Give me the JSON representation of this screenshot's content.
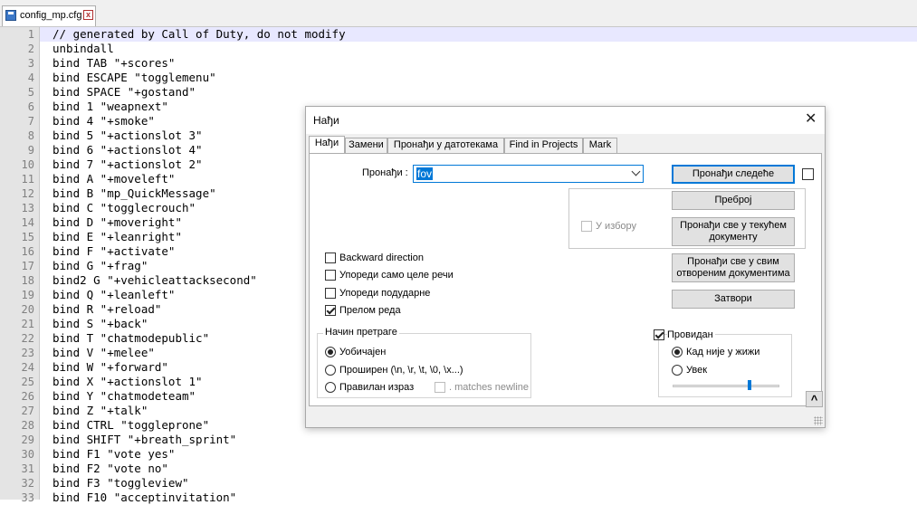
{
  "file_tab": {
    "name": "config_mp.cfg"
  },
  "editor": {
    "lines": [
      "// generated by Call of Duty, do not modify",
      "unbindall",
      "bind TAB \"+scores\"",
      "bind ESCAPE \"togglemenu\"",
      "bind SPACE \"+gostand\"",
      "bind 1 \"weapnext\"",
      "bind 4 \"+smoke\"",
      "bind 5 \"+actionslot 3\"",
      "bind 6 \"+actionslot 4\"",
      "bind 7 \"+actionslot 2\"",
      "bind A \"+moveleft\"",
      "bind B \"mp_QuickMessage\"",
      "bind C \"togglecrouch\"",
      "bind D \"+moveright\"",
      "bind E \"+leanright\"",
      "bind F \"+activate\"",
      "bind G \"+frag\"",
      "bind2 G \"+vehicleattacksecond\"",
      "bind Q \"+leanleft\"",
      "bind R \"+reload\"",
      "bind S \"+back\"",
      "bind T \"chatmodepublic\"",
      "bind V \"+melee\"",
      "bind W \"+forward\"",
      "bind X \"+actionslot 1\"",
      "bind Y \"chatmodeteam\"",
      "bind Z \"+talk\"",
      "bind CTRL \"toggleprone\"",
      "bind SHIFT \"+breath_sprint\"",
      "bind F1 \"vote yes\"",
      "bind F2 \"vote no\"",
      "bind F3 \"toggleview\"",
      "bind F10 \"acceptinvitation\""
    ]
  },
  "dialog": {
    "title": "Нађи",
    "close_glyph": "✕",
    "tabs": [
      "Нађи",
      "Замени",
      "Пронађи у датотекама",
      "Find in Projects",
      "Mark"
    ],
    "find_label": "Пронађи :",
    "find_value": "fov",
    "buttons": {
      "find_next": "Пронађи следеће",
      "count": "Преброј",
      "find_all_current": "Пронађи све у текућем документу",
      "find_all_open": "Пронађи све у свим отвореним документима",
      "close": "Затвори"
    },
    "in_selection": "У избору",
    "options": {
      "backward": "Backward direction",
      "whole_word": "Упореди само целе речи",
      "match_case": "Упореди подударне",
      "wrap": "Прелом реда"
    },
    "search_mode": {
      "title": "Начин претраге",
      "normal": "Уобичајен",
      "extended": "Проширен (\\n, \\r, \\t, \\0, \\x...)",
      "regex": "Правилан израз",
      "matches_newline": ". matches newline"
    },
    "transparency": {
      "title": "Провидан",
      "on_lose_focus": "Кад није у жижи",
      "always": "Увек",
      "level": 0.72
    },
    "collapse_glyph": "^"
  }
}
